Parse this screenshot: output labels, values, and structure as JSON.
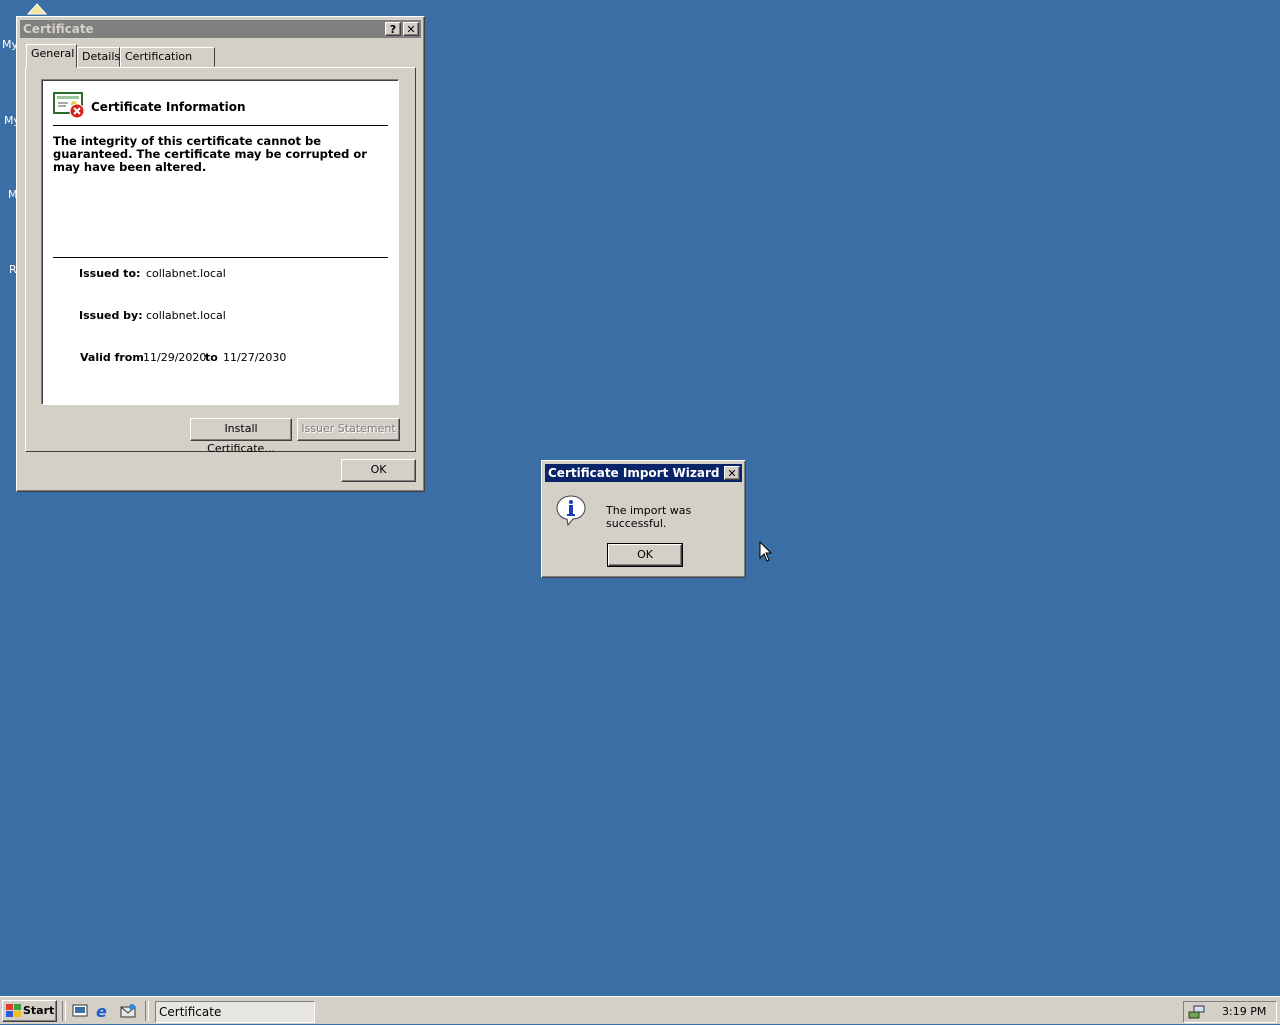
{
  "desktop": {
    "icon_labels": [
      "My",
      "My",
      "M",
      "R"
    ]
  },
  "cert_window": {
    "title": "Certificate",
    "help_btn": "?",
    "close_btn": "✕",
    "tabs": [
      "General",
      "Details",
      "Certification Path"
    ],
    "info_heading": "Certificate Information",
    "warning_text": "The integrity of this certificate cannot be guaranteed. The certificate may be corrupted or may have been altered.",
    "issued_to_label": "Issued to:",
    "issued_to_value": "collabnet.local",
    "issued_by_label": "Issued by:",
    "issued_by_value": "collabnet.local",
    "valid_from_label": "Valid from",
    "valid_from_value": "11/29/2020",
    "valid_to_label": "to",
    "valid_to_value": "11/27/2030",
    "install_button": "Install Certificate...",
    "issuer_statement_button": "Issuer Statement",
    "ok_button": "OK"
  },
  "wizard_dialog": {
    "title": "Certificate Import Wizard",
    "close_btn": "✕",
    "message": "The import was successful.",
    "ok_button": "OK",
    "icon": "info-icon"
  },
  "taskbar": {
    "start_label": "Start",
    "task_button": "Certificate",
    "clock": "3:19 PM"
  },
  "colors": {
    "desktop": "#3a6ea5",
    "active_title": "#0a246a",
    "inactive_title": "#808080",
    "face": "#d4d0c8"
  }
}
